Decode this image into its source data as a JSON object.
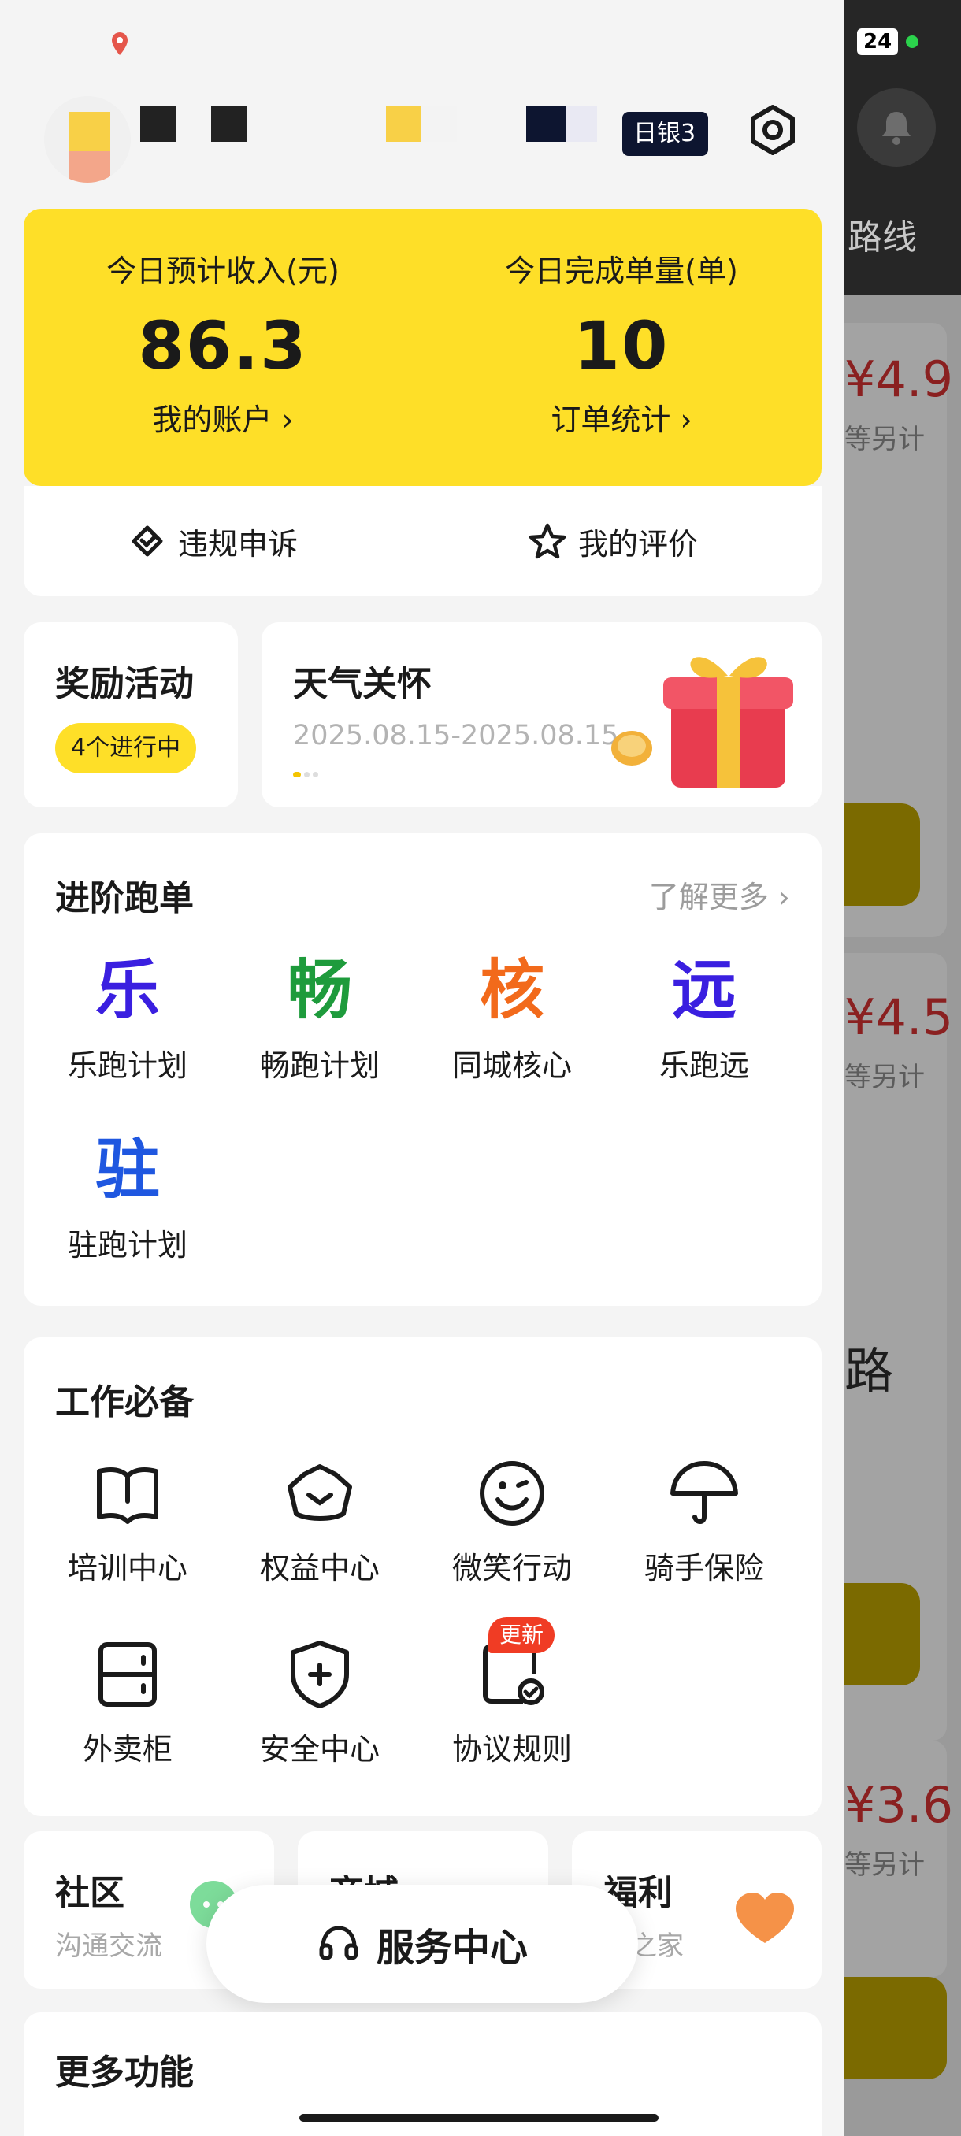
{
  "status_bar": {
    "battery": "24"
  },
  "profile": {
    "badge": "日银3"
  },
  "earnings": {
    "income_label": "今日预计收入(元)",
    "income_value": "86.3",
    "account_link": "我的账户 ›",
    "orders_label": "今日完成单量(单)",
    "orders_value": "10",
    "stats_link": "订单统计 ›"
  },
  "quick_actions": {
    "appeal": "违规申诉",
    "rating": "我的评价"
  },
  "rewards": {
    "title": "奖励活动",
    "badge": "4个进行中"
  },
  "weather": {
    "title": "天气关怀",
    "date": "2025.08.15-2025.08.15"
  },
  "advanced": {
    "title": "进阶跑单",
    "more": "了解更多 ›",
    "items": [
      {
        "glyph": "乐",
        "label": "乐跑计划",
        "color": "#3a1fe0"
      },
      {
        "glyph": "畅",
        "label": "畅跑计划",
        "color": "#1e9b3c"
      },
      {
        "glyph": "核",
        "label": "同城核心",
        "color": "#f26a1b"
      },
      {
        "glyph": "远",
        "label": "乐跑远",
        "color": "#3a1fe0"
      },
      {
        "glyph": "驻",
        "label": "驻跑计划",
        "color": "#1f57e0"
      }
    ]
  },
  "work": {
    "title": "工作必备",
    "items": [
      {
        "label": "培训中心",
        "icon": "book-icon"
      },
      {
        "label": "权益中心",
        "icon": "crown-icon"
      },
      {
        "label": "微笑行动",
        "icon": "smile-icon"
      },
      {
        "label": "骑手保险",
        "icon": "umbrella-icon"
      },
      {
        "label": "外卖柜",
        "icon": "locker-icon"
      },
      {
        "label": "安全中心",
        "icon": "shield-plus-icon"
      },
      {
        "label": "协议规则",
        "icon": "document-check-icon"
      }
    ],
    "new_badge": "更新"
  },
  "mini_cards": {
    "community": {
      "title": "社区",
      "sub": "沟通交流"
    },
    "mall": {
      "title": "商城"
    },
    "welfare": {
      "title": "福利",
      "sub": "手之家"
    }
  },
  "service_center": {
    "label": "服务中心"
  },
  "more_functions": {
    "title": "更多功能"
  },
  "background_app": {
    "route_text": "路线",
    "prices": [
      "¥4.9",
      "¥4.5",
      "¥3.6"
    ],
    "sub": "等另计",
    "road": "路"
  }
}
